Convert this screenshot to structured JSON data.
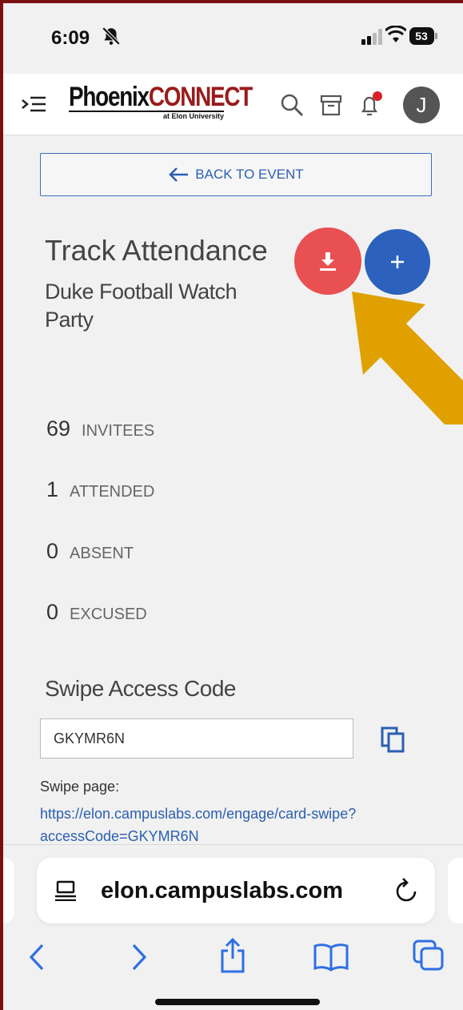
{
  "status_bar": {
    "time": "6:09",
    "battery": "53"
  },
  "header": {
    "logo_main": "Phoenix",
    "logo_accent": "CONNECT",
    "logo_sub": "at Elon University",
    "avatar_initial": "J"
  },
  "back_button": {
    "label": "BACK TO EVENT"
  },
  "page": {
    "title": "Track Attendance",
    "event_name": "Duke Football Watch Party"
  },
  "stats": [
    {
      "count": "69",
      "label": "INVITEES"
    },
    {
      "count": "1",
      "label": "ATTENDED"
    },
    {
      "count": "0",
      "label": "ABSENT"
    },
    {
      "count": "0",
      "label": "EXCUSED"
    }
  ],
  "swipe": {
    "title": "Swipe Access Code",
    "code": "GKYMR6N",
    "page_label": "Swipe page:",
    "link": "https://elon.campuslabs.com/engage/card-swipe?accessCode=GKYMR6N"
  },
  "browser": {
    "url": "elon.campuslabs.com"
  },
  "colors": {
    "download": "#e95052",
    "add": "#2c62bd",
    "arrow": "#e0a100",
    "link": "#2a5fb3",
    "brand": "#7a1010"
  }
}
